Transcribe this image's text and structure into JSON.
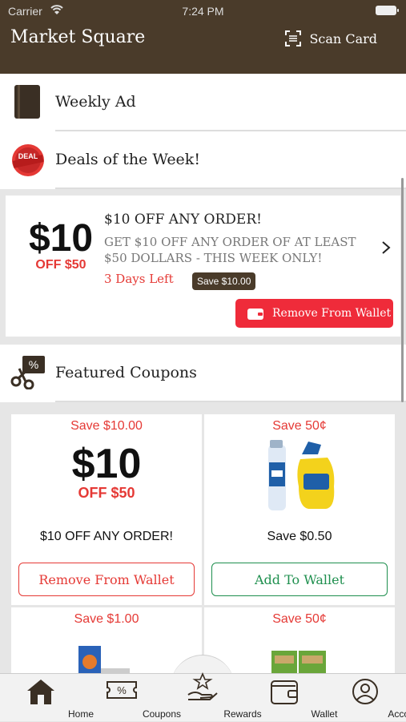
{
  "status": {
    "carrier": "Carrier",
    "time": "7:24 PM"
  },
  "header": {
    "title": "Market Square",
    "scan_label": "Scan Card"
  },
  "sections": {
    "weekly_ad": "Weekly Ad",
    "deals": "Deals of the Week!",
    "featured": "Featured Coupons"
  },
  "deal": {
    "big": "$10",
    "off": "OFF $50",
    "title": "$10 OFF ANY ORDER!",
    "desc": "GET $10 OFF ANY ORDER OF AT LEAST $50 DOLLARS - THIS WEEK ONLY!",
    "days_left": "3 Days Left",
    "save_badge": "Save $10.00",
    "remove_label": "Remove From Wallet"
  },
  "coupons": [
    {
      "save": "Save $10.00",
      "big": "$10",
      "off": "OFF $50",
      "name": "$10 OFF ANY ORDER!",
      "button": "Remove From Wallet"
    },
    {
      "save": "Save 50¢",
      "name": "Save $0.50",
      "button": "Add To Wallet"
    },
    {
      "save": "Save $1.00"
    },
    {
      "save": "Save 50¢"
    }
  ],
  "tabs": [
    "Home",
    "Coupons",
    "Rewards",
    "Wallet",
    "Account"
  ],
  "colors": {
    "brand": "#4a3b2a",
    "accent_red": "#ef2b3a",
    "green": "#1e8f4e"
  }
}
